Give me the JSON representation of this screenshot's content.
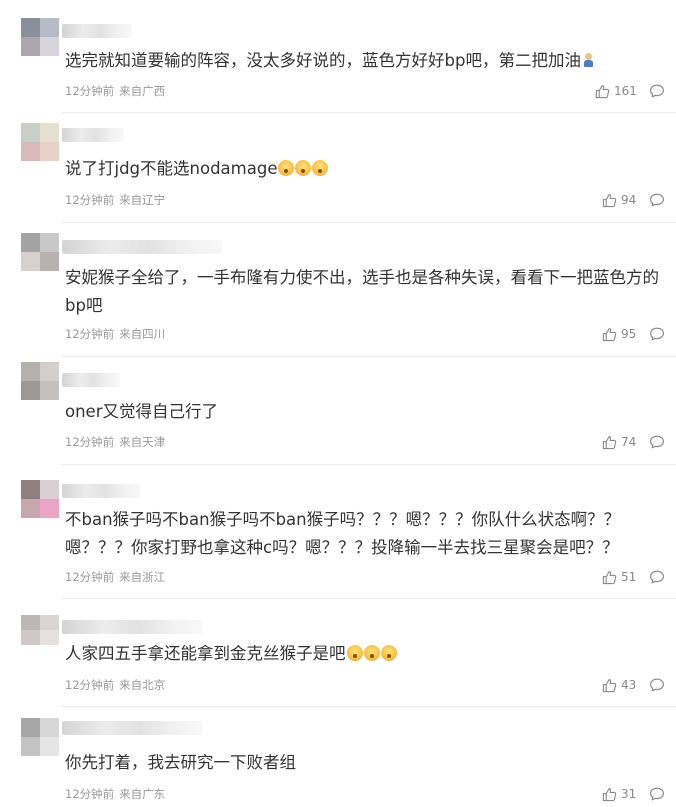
{
  "like_icon": "thumbs-up-icon",
  "reply_icon": "comment-bubble-icon",
  "emoji_names": [
    "astonished-face-emoji",
    "person-emoji"
  ],
  "comments": [
    {
      "text": "选完就知道要输的阵容，没太多好说的，蓝色方好好bp吧，第二把加油",
      "time": "12分钟前",
      "location": "来自广西",
      "likes": "161"
    },
    {
      "text": "说了打jdg不能选nodamage",
      "time": "12分钟前",
      "location": "来自辽宁",
      "likes": "94"
    },
    {
      "text": "安妮猴子全给了，一手布隆有力使不出，选手也是各种失误，看看下一把蓝色方的bp吧",
      "time": "12分钟前",
      "location": "来自四川",
      "likes": "95"
    },
    {
      "text": "oner又觉得自己行了",
      "time": "12分钟前",
      "location": "来自天津",
      "likes": "74"
    },
    {
      "text": "不ban猴子吗不ban猴子吗不ban猴子吗？？？嗯？？？你队什么状态啊？？嗯？？？你家打野也拿这种c吗？嗯？？？投降输一半去找三星聚会是吧？？",
      "time": "12分钟前",
      "location": "来自浙江",
      "likes": "51"
    },
    {
      "text": "人家四五手拿还能拿到金克丝猴子是吧",
      "time": "12分钟前",
      "location": "来自北京",
      "likes": "43"
    },
    {
      "text": "你先打着，我去研究一下败者组",
      "time": "12分钟前",
      "location": "来自广东",
      "likes": "31"
    }
  ]
}
